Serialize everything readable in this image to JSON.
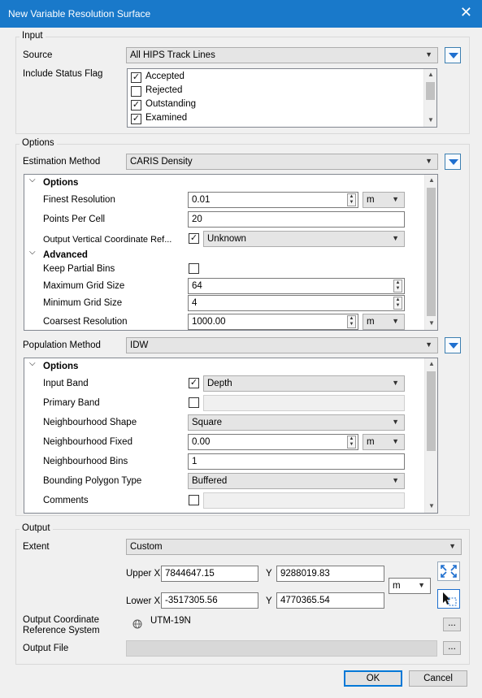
{
  "window": {
    "title": "New Variable Resolution Surface",
    "close_glyph": "✕"
  },
  "input": {
    "group_label": "Input",
    "source_label": "Source",
    "source_value": "All HIPS Track Lines",
    "status_flag_label": "Include Status Flag",
    "status_flags": [
      {
        "label": "Accepted",
        "checked": true
      },
      {
        "label": "Rejected",
        "checked": false
      },
      {
        "label": "Outstanding",
        "checked": true
      },
      {
        "label": "Examined",
        "checked": true
      }
    ]
  },
  "options": {
    "group_label": "Options",
    "estimation_label": "Estimation Method",
    "estimation_value": "CARIS Density",
    "est_panel": {
      "options_header": "Options",
      "finest_label": "Finest Resolution",
      "finest_value": "0.01",
      "finest_unit": "m",
      "ppc_label": "Points Per Cell",
      "ppc_value": "20",
      "ovcr_label": "Output Vertical Coordinate Ref...",
      "ovcr_value": "Unknown",
      "advanced_header": "Advanced",
      "kpb_label": "Keep Partial Bins",
      "maxgrid_label": "Maximum Grid Size",
      "maxgrid_value": "64",
      "mingrid_label": "Minimum Grid Size",
      "mingrid_value": "4",
      "coarse_label": "Coarsest Resolution",
      "coarse_value": "1000.00",
      "coarse_unit": "m"
    },
    "population_label": "Population Method",
    "population_value": "IDW",
    "pop_panel": {
      "options_header": "Options",
      "inputband_label": "Input Band",
      "inputband_value": "Depth",
      "primaryband_label": "Primary Band",
      "nshape_label": "Neighbourhood Shape",
      "nshape_value": "Square",
      "nfixed_label": "Neighbourhood Fixed",
      "nfixed_value": "0.00",
      "nfixed_unit": "m",
      "nbins_label": "Neighbourhood Bins",
      "nbins_value": "1",
      "bpt_label": "Bounding Polygon Type",
      "bpt_value": "Buffered",
      "comments_label": "Comments"
    }
  },
  "output": {
    "group_label": "Output",
    "extent_label": "Extent",
    "extent_value": "Custom",
    "upperx_label": "Upper X",
    "upperx_value": "7844647.15",
    "uppery_label": "Y",
    "uppery_value": "9288019.83",
    "lowerx_label": "Lower X",
    "lowerx_value": "-3517305.56",
    "lowery_label": "Y",
    "lowery_value": "4770365.54",
    "extent_unit": "m",
    "ocrs_label_line1": "Output Coordinate",
    "ocrs_label_line2": "Reference System",
    "ocrs_value": "UTM-19N",
    "outfile_label": "Output File",
    "browse_label": "..."
  },
  "buttons": {
    "ok": "OK",
    "cancel": "Cancel"
  },
  "glyphs": {
    "check": "✓",
    "dropdown": "▼",
    "collapse": "⌄",
    "up": "▲",
    "down": "▼"
  },
  "colors": {
    "titlebar": "#1979ca",
    "accent": "#1e6fcf"
  }
}
